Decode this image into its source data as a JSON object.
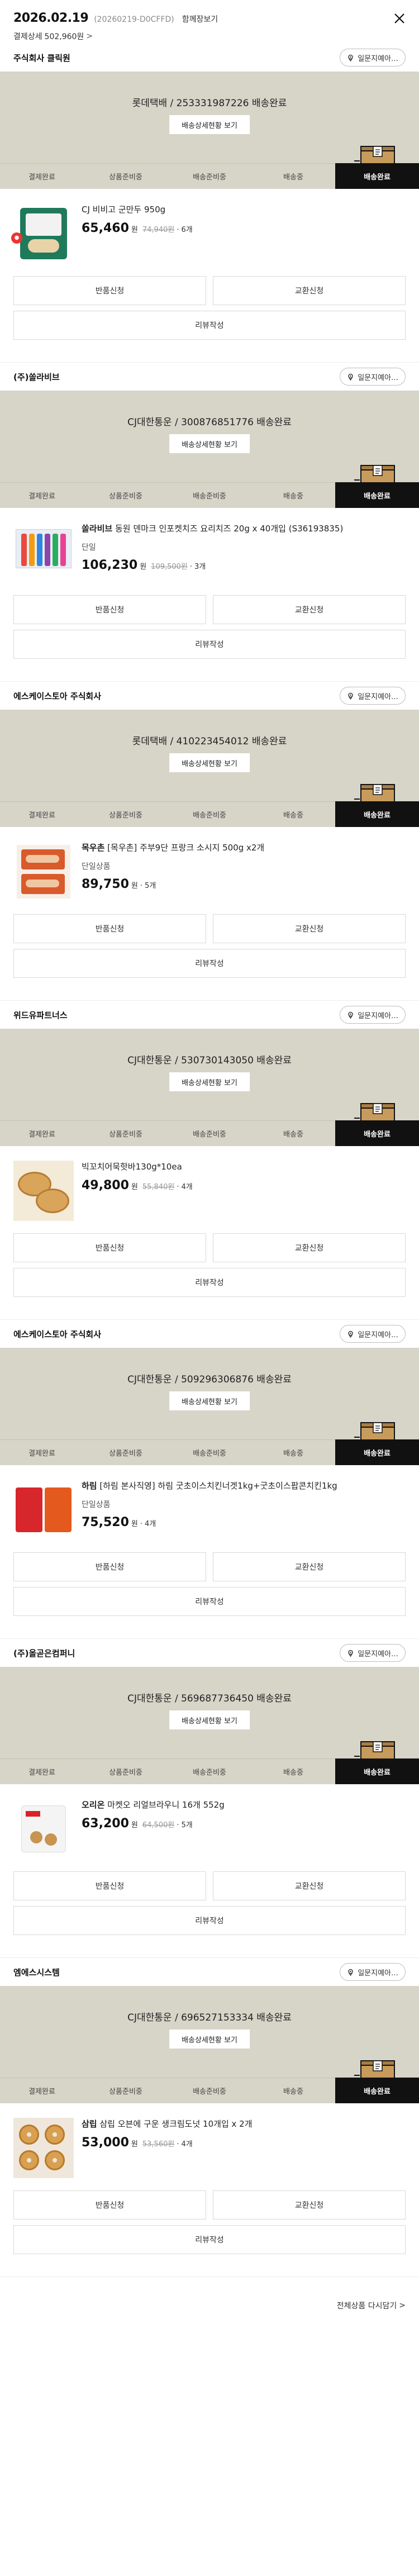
{
  "header": {
    "date": "2026.02.19",
    "order_no": "(20260219-D0CFFD)",
    "same_view": "함께장보기",
    "payment_label": "결제상세",
    "payment_amount": "502,960원",
    "payment_chevron": ">"
  },
  "common": {
    "inquiry_label": "일문지예아…",
    "tracking_label": "배송상세현황 보기",
    "steps": [
      "결제완료",
      "상품준비중",
      "배송준비중",
      "배송중",
      "배송완료"
    ],
    "active_step_index": 4,
    "return_label": "반품신청",
    "exchange_label": "교환신청",
    "review_label": "리뷰작성",
    "won": "원",
    "separator": "·"
  },
  "orders": [
    {
      "seller": "주식회사 클릭원",
      "delivery_status": "롯데택배 / 253331987226 배송완료",
      "product_brand": "",
      "product_name": "CJ 비비고 군만두 950g",
      "option": "",
      "price": "65,460",
      "original_price": "74,940원",
      "qty": "6개",
      "thumb": "bibigo"
    },
    {
      "seller": "(주)쏠라비브",
      "delivery_status": "CJ대한통운 / 300876851776 배송완료",
      "product_brand": "쏠라비브",
      "product_name": " 동원 덴마크 인포켓치즈 요리치즈 20g x 40개입 (S36193835)",
      "option": "단일",
      "price": "106,230",
      "original_price": "109,500원",
      "qty": "3개",
      "thumb": "jelly"
    },
    {
      "seller": "에스케이스토아 주식회사",
      "delivery_status": "롯데택배 / 410223454012 배송완료",
      "product_brand": "목우촌",
      "product_name": " [목우촌] 주부9단 프랑크 소시지 500g x2개",
      "option": "단일상품",
      "price": "89,750",
      "original_price": "",
      "qty": "5개",
      "thumb": "sausage"
    },
    {
      "seller": "위드유파트너스",
      "delivery_status": "CJ대한통운 / 530730143050 배송완료",
      "product_brand": "",
      "product_name": "빅꼬치어묵핫바130g*10ea",
      "option": "",
      "price": "49,800",
      "original_price": "55,840원",
      "qty": "4개",
      "thumb": "pancake"
    },
    {
      "seller": "에스케이스토아 주식회사",
      "delivery_status": "CJ대한통운 / 509296306876 배송완료",
      "product_brand": "하림",
      "product_name": " [하림 본사직영] 하림 굿초이스치킨너겟1kg+굿초이스팝콘치킨1kg",
      "option": "단일상품",
      "price": "75,520",
      "original_price": "",
      "qty": "4개",
      "thumb": "chicken"
    },
    {
      "seller": "(주)올곧은컴퍼니",
      "delivery_status": "CJ대한통운 / 569687736450 배송완료",
      "product_brand": "오리온",
      "product_name": " 마켓오 리얼브라우니 16개 552g",
      "option": "",
      "price": "63,200",
      "original_price": "64,500원",
      "qty": "5개",
      "thumb": "snack"
    },
    {
      "seller": "엠에스시스템",
      "delivery_status": "CJ대한통운 / 696527153334 배송완료",
      "product_brand": "삼립",
      "product_name": " 삼립 오븐에 구운 생크림도넛 10개입 x 2개",
      "option": "",
      "price": "53,000",
      "original_price": "53,560원",
      "qty": "4개",
      "thumb": "donut"
    }
  ],
  "footer": {
    "rebuy_label": "전체상품 다시담기",
    "rebuy_chevron": ">"
  }
}
